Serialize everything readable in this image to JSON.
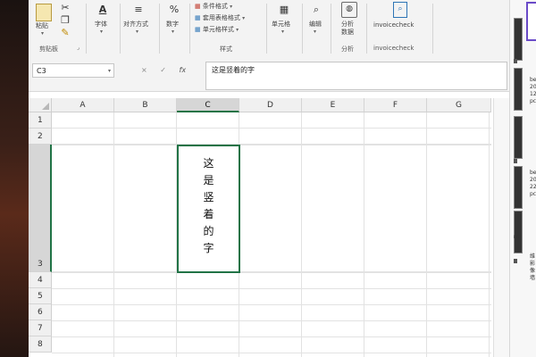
{
  "ribbon": {
    "paste": "粘贴",
    "clipboard_group": "剪贴板",
    "font": "字体",
    "alignment": "对齐方式",
    "number": "数字",
    "cond_format": "条件格式",
    "table_format": "套用表格格式",
    "cell_style": "单元格样式",
    "styles_group": "样式",
    "cells": "单元格",
    "editing": "编辑",
    "analyze_line1": "分析",
    "analyze_line2": "数据",
    "analysis_group": "分析",
    "invoice_button": "invoicecheck",
    "invoice_group": "invoicecheck"
  },
  "formula_bar": {
    "namebox": "C3",
    "fx": "fx",
    "cancel": "×",
    "enter": "✓",
    "content": "这是竖着的字"
  },
  "columns": [
    "A",
    "B",
    "C",
    "D",
    "E",
    "F",
    "G"
  ],
  "rows": [
    "1",
    "2",
    "3",
    "4",
    "5",
    "6",
    "7",
    "8"
  ],
  "cell_c3": [
    "这",
    "是",
    "竖",
    "着",
    "的",
    "字"
  ],
  "right_panel": {
    "lines_a": [
      "be",
      "20",
      "12",
      "pc"
    ],
    "lines_b": [
      "be",
      "20",
      "22",
      "pc"
    ],
    "lines_c": [
      "维",
      "影",
      "像",
      "墙"
    ],
    "m1": "m",
    "m2": "m"
  }
}
